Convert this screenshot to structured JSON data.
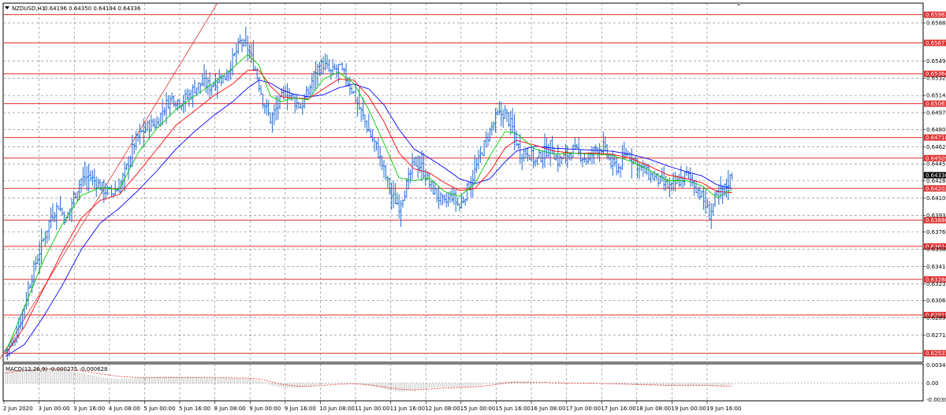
{
  "chart_data": [
    {
      "type": "candlestick",
      "title": "NZDUSD,H1",
      "ohlc_readout": "0.64196 0.64350 0.64194 0.64336",
      "price_range": [
        0.6244,
        0.6608
      ],
      "y_ticks": [
        "0.65880",
        "0.65495",
        "0.65320",
        "0.65145",
        "0.64970",
        "0.64800",
        "0.64625",
        "0.64450",
        "0.64280",
        "0.64105",
        "0.63930",
        "0.63760",
        "0.63585",
        "0.63410",
        "0.63235",
        "0.63065",
        "0.62890",
        "0.62715"
      ],
      "y_tick_values": [
        0.6588,
        0.65495,
        0.6532,
        0.65145,
        0.6497,
        0.648,
        0.64625,
        0.6445,
        0.6428,
        0.64105,
        0.6393,
        0.6376,
        0.63585,
        0.6341,
        0.63235,
        0.63065,
        0.6289,
        0.62715
      ],
      "x_ticks": [
        "2 Jun 2020",
        "3 Jun 00:00",
        "3 Jun 16:00",
        "4 Jun 08:00",
        "5 Jun 00:00",
        "5 Jun 16:00",
        "8 Jun 08:00",
        "9 Jun 00:00",
        "9 Jun 16:00",
        "10 Jun 08:00",
        "11 Jun 00:00",
        "11 Jun 16:00",
        "12 Jun 08:00",
        "15 Jun 00:00",
        "15 Jun 16:00",
        "16 Jun 08:00",
        "17 Jun 00:00",
        "17 Jun 16:00",
        "18 Jun 08:00",
        "19 Jun 00:00",
        "19 Jun 16:00"
      ],
      "levels": [
        "0.65963",
        "0.65677",
        "0.65364",
        "0.65061",
        "0.64718",
        "0.64509",
        "0.64202",
        "0.63880",
        "0.63614",
        "0.63280",
        "0.62919",
        "0.62531"
      ],
      "current_price": "0.64336",
      "price_path": [
        [
          0,
          0.6256
        ],
        [
          4,
          0.6263
        ],
        [
          8,
          0.6288
        ],
        [
          12,
          0.6318
        ],
        [
          16,
          0.6345
        ],
        [
          20,
          0.6368
        ],
        [
          24,
          0.6392
        ],
        [
          28,
          0.6403
        ],
        [
          32,
          0.6387
        ],
        [
          36,
          0.6412
        ],
        [
          40,
          0.6429
        ],
        [
          44,
          0.6433
        ],
        [
          48,
          0.6426
        ],
        [
          52,
          0.6419
        ],
        [
          56,
          0.6415
        ],
        [
          60,
          0.6421
        ],
        [
          64,
          0.6441
        ],
        [
          68,
          0.6466
        ],
        [
          72,
          0.6477
        ],
        [
          76,
          0.6484
        ],
        [
          80,
          0.6486
        ],
        [
          84,
          0.6503
        ],
        [
          88,
          0.6512
        ],
        [
          92,
          0.6508
        ],
        [
          96,
          0.6512
        ],
        [
          100,
          0.6522
        ],
        [
          104,
          0.6527
        ],
        [
          108,
          0.6524
        ],
        [
          112,
          0.6531
        ],
        [
          116,
          0.6533
        ],
        [
          120,
          0.655
        ],
        [
          124,
          0.6568
        ],
        [
          128,
          0.6562
        ],
        [
          132,
          0.6541
        ],
        [
          136,
          0.651
        ],
        [
          140,
          0.649
        ],
        [
          144,
          0.6504
        ],
        [
          148,
          0.6519
        ],
        [
          152,
          0.651
        ],
        [
          156,
          0.6503
        ],
        [
          160,
          0.6518
        ],
        [
          164,
          0.654
        ],
        [
          168,
          0.6546
        ],
        [
          172,
          0.6537
        ],
        [
          176,
          0.6543
        ],
        [
          180,
          0.6532
        ],
        [
          184,
          0.6517
        ],
        [
          188,
          0.6497
        ],
        [
          192,
          0.6478
        ],
        [
          196,
          0.6462
        ],
        [
          200,
          0.6438
        ],
        [
          204,
          0.6413
        ],
        [
          208,
          0.6403
        ],
        [
          212,
          0.6423
        ],
        [
          216,
          0.6447
        ],
        [
          220,
          0.6442
        ],
        [
          224,
          0.6425
        ],
        [
          228,
          0.6413
        ],
        [
          232,
          0.6404
        ],
        [
          236,
          0.6413
        ],
        [
          240,
          0.6401
        ],
        [
          244,
          0.6419
        ],
        [
          248,
          0.6437
        ],
        [
          252,
          0.6459
        ],
        [
          256,
          0.6478
        ],
        [
          260,
          0.6494
        ],
        [
          264,
          0.6497
        ],
        [
          268,
          0.6481
        ],
        [
          272,
          0.6456
        ],
        [
          276,
          0.6458
        ],
        [
          280,
          0.6447
        ],
        [
          284,
          0.6455
        ],
        [
          288,
          0.6463
        ],
        [
          292,
          0.6448
        ],
        [
          296,
          0.6453
        ],
        [
          300,
          0.6459
        ],
        [
          304,
          0.6454
        ],
        [
          308,
          0.6448
        ],
        [
          312,
          0.6461
        ],
        [
          316,
          0.6462
        ],
        [
          320,
          0.6445
        ],
        [
          324,
          0.6441
        ],
        [
          328,
          0.6456
        ],
        [
          332,
          0.645
        ],
        [
          336,
          0.644
        ],
        [
          340,
          0.6434
        ],
        [
          344,
          0.643
        ],
        [
          348,
          0.6424
        ],
        [
          352,
          0.6421
        ],
        [
          356,
          0.6428
        ],
        [
          360,
          0.6434
        ],
        [
          364,
          0.6425
        ],
        [
          368,
          0.6412
        ],
        [
          372,
          0.6394
        ],
        [
          376,
          0.6413
        ],
        [
          380,
          0.642
        ],
        [
          384,
          0.6434
        ]
      ],
      "ma_fast": [
        [
          0,
          0.6254
        ],
        [
          10,
          0.63
        ],
        [
          20,
          0.6347
        ],
        [
          30,
          0.6384
        ],
        [
          40,
          0.6413
        ],
        [
          50,
          0.6421
        ],
        [
          60,
          0.6419
        ],
        [
          70,
          0.6456
        ],
        [
          80,
          0.6481
        ],
        [
          90,
          0.65
        ],
        [
          100,
          0.6514
        ],
        [
          110,
          0.6527
        ],
        [
          120,
          0.6542
        ],
        [
          128,
          0.6556
        ],
        [
          134,
          0.6545
        ],
        [
          140,
          0.6514
        ],
        [
          146,
          0.6508
        ],
        [
          152,
          0.6512
        ],
        [
          160,
          0.651
        ],
        [
          168,
          0.6531
        ],
        [
          176,
          0.6538
        ],
        [
          184,
          0.6527
        ],
        [
          192,
          0.65
        ],
        [
          200,
          0.6466
        ],
        [
          208,
          0.6431
        ],
        [
          216,
          0.6428
        ],
        [
          224,
          0.6431
        ],
        [
          232,
          0.6417
        ],
        [
          240,
          0.6412
        ],
        [
          248,
          0.6425
        ],
        [
          256,
          0.6453
        ],
        [
          264,
          0.6478
        ],
        [
          270,
          0.6476
        ],
        [
          280,
          0.646
        ],
        [
          290,
          0.6455
        ],
        [
          300,
          0.6456
        ],
        [
          310,
          0.6455
        ],
        [
          320,
          0.6454
        ],
        [
          330,
          0.6448
        ],
        [
          340,
          0.6439
        ],
        [
          350,
          0.6428
        ],
        [
          360,
          0.6428
        ],
        [
          368,
          0.6423
        ],
        [
          376,
          0.6411
        ],
        [
          384,
          0.6419
        ]
      ],
      "ma_mid": [
        [
          0,
          0.6252
        ],
        [
          10,
          0.628
        ],
        [
          20,
          0.6318
        ],
        [
          30,
          0.6356
        ],
        [
          40,
          0.639
        ],
        [
          50,
          0.6408
        ],
        [
          60,
          0.6414
        ],
        [
          70,
          0.6436
        ],
        [
          80,
          0.646
        ],
        [
          90,
          0.6484
        ],
        [
          100,
          0.6499
        ],
        [
          110,
          0.6514
        ],
        [
          120,
          0.6526
        ],
        [
          128,
          0.654
        ],
        [
          134,
          0.654
        ],
        [
          140,
          0.6524
        ],
        [
          146,
          0.6513
        ],
        [
          152,
          0.6512
        ],
        [
          160,
          0.6511
        ],
        [
          168,
          0.6521
        ],
        [
          176,
          0.6531
        ],
        [
          184,
          0.653
        ],
        [
          192,
          0.6513
        ],
        [
          200,
          0.6488
        ],
        [
          208,
          0.6456
        ],
        [
          216,
          0.644
        ],
        [
          224,
          0.6436
        ],
        [
          232,
          0.6426
        ],
        [
          240,
          0.6418
        ],
        [
          248,
          0.642
        ],
        [
          256,
          0.6437
        ],
        [
          264,
          0.6461
        ],
        [
          270,
          0.6469
        ],
        [
          280,
          0.6464
        ],
        [
          290,
          0.6458
        ],
        [
          300,
          0.6456
        ],
        [
          310,
          0.6456
        ],
        [
          320,
          0.6455
        ],
        [
          330,
          0.6451
        ],
        [
          340,
          0.6443
        ],
        [
          350,
          0.6434
        ],
        [
          360,
          0.643
        ],
        [
          368,
          0.6426
        ],
        [
          376,
          0.6417
        ],
        [
          384,
          0.6416
        ]
      ],
      "ma_slow": [
        [
          0,
          0.625
        ],
        [
          10,
          0.6262
        ],
        [
          20,
          0.629
        ],
        [
          30,
          0.6322
        ],
        [
          40,
          0.6358
        ],
        [
          50,
          0.6385
        ],
        [
          60,
          0.64
        ],
        [
          70,
          0.6418
        ],
        [
          80,
          0.6438
        ],
        [
          90,
          0.646
        ],
        [
          100,
          0.6478
        ],
        [
          110,
          0.6494
        ],
        [
          120,
          0.6508
        ],
        [
          128,
          0.6522
        ],
        [
          134,
          0.653
        ],
        [
          140,
          0.6527
        ],
        [
          146,
          0.652
        ],
        [
          152,
          0.6516
        ],
        [
          160,
          0.6513
        ],
        [
          168,
          0.6515
        ],
        [
          176,
          0.6522
        ],
        [
          184,
          0.6526
        ],
        [
          192,
          0.6521
        ],
        [
          200,
          0.6505
        ],
        [
          208,
          0.648
        ],
        [
          216,
          0.646
        ],
        [
          224,
          0.6451
        ],
        [
          232,
          0.6441
        ],
        [
          240,
          0.643
        ],
        [
          248,
          0.6425
        ],
        [
          256,
          0.643
        ],
        [
          264,
          0.6447
        ],
        [
          270,
          0.6458
        ],
        [
          280,
          0.6463
        ],
        [
          290,
          0.6461
        ],
        [
          300,
          0.646
        ],
        [
          310,
          0.6459
        ],
        [
          320,
          0.6458
        ],
        [
          330,
          0.6455
        ],
        [
          340,
          0.645
        ],
        [
          350,
          0.6443
        ],
        [
          360,
          0.6437
        ],
        [
          368,
          0.6433
        ],
        [
          376,
          0.6424
        ],
        [
          384,
          0.642
        ]
      ],
      "trendline": [
        [
          -4,
          0.6244
        ],
        [
          112,
          0.6608
        ]
      ],
      "colors": {
        "price": "#1e6bd6",
        "ma_fast": "#00cc00",
        "ma_mid": "#ff0000",
        "ma_slow": "#0000ff",
        "level": "#e03030",
        "grid": "#7a7a7a",
        "border": "#000000",
        "current_bg": "#000000"
      }
    },
    {
      "type": "bar",
      "title": "MACD(12,26,9) -0.000275 -0.000628",
      "y_ticks": [
        "0.003476",
        "0.00",
        "-0.003092"
      ],
      "y_tick_values": [
        0.003476,
        0.0,
        -0.003092
      ],
      "y_range": [
        -0.00335,
        0.0037
      ],
      "histogram": [
        [
          0,
          0.0022
        ],
        [
          10,
          0.0028
        ],
        [
          20,
          0.003
        ],
        [
          30,
          0.0026
        ],
        [
          40,
          0.002
        ],
        [
          50,
          0.0012
        ],
        [
          60,
          0.0008
        ],
        [
          70,
          0.001
        ],
        [
          80,
          0.0012
        ],
        [
          90,
          0.0012
        ],
        [
          100,
          0.0011
        ],
        [
          110,
          0.001
        ],
        [
          120,
          0.001
        ],
        [
          128,
          0.0009
        ],
        [
          134,
          0.0005
        ],
        [
          140,
          -0.0004
        ],
        [
          146,
          -0.0008
        ],
        [
          152,
          -0.0009
        ],
        [
          160,
          -0.0006
        ],
        [
          168,
          -0.0002
        ],
        [
          176,
          0.0001
        ],
        [
          184,
          -0.0001
        ],
        [
          192,
          -0.0005
        ],
        [
          200,
          -0.0011
        ],
        [
          208,
          -0.0016
        ],
        [
          216,
          -0.0014
        ],
        [
          224,
          -0.0008
        ],
        [
          232,
          -0.0007
        ],
        [
          240,
          -0.0008
        ],
        [
          248,
          -0.0006
        ],
        [
          256,
          0.0
        ],
        [
          264,
          0.0004
        ],
        [
          270,
          0.0003
        ],
        [
          280,
          0.0001
        ],
        [
          290,
          0.0
        ],
        [
          300,
          0.0
        ],
        [
          310,
          -0.0001
        ],
        [
          320,
          -0.0001
        ],
        [
          330,
          -0.0003
        ],
        [
          340,
          -0.0004
        ],
        [
          350,
          -0.0005
        ],
        [
          360,
          -0.0004
        ],
        [
          368,
          -0.0004
        ],
        [
          376,
          -0.0006
        ],
        [
          384,
          -0.0003
        ]
      ],
      "signal": [
        [
          0,
          0.002
        ],
        [
          10,
          0.0024
        ],
        [
          20,
          0.0027
        ],
        [
          30,
          0.0027
        ],
        [
          40,
          0.0024
        ],
        [
          50,
          0.0018
        ],
        [
          60,
          0.0013
        ],
        [
          70,
          0.0011
        ],
        [
          80,
          0.0011
        ],
        [
          90,
          0.0011
        ],
        [
          100,
          0.0011
        ],
        [
          110,
          0.0011
        ],
        [
          120,
          0.001
        ],
        [
          128,
          0.001
        ],
        [
          134,
          0.0008
        ],
        [
          140,
          0.0003
        ],
        [
          146,
          -0.0002
        ],
        [
          152,
          -0.0005
        ],
        [
          160,
          -0.0006
        ],
        [
          168,
          -0.0004
        ],
        [
          176,
          -0.0002
        ],
        [
          184,
          -0.0001
        ],
        [
          192,
          -0.0003
        ],
        [
          200,
          -0.0007
        ],
        [
          208,
          -0.0011
        ],
        [
          216,
          -0.0013
        ],
        [
          224,
          -0.0011
        ],
        [
          232,
          -0.0009
        ],
        [
          240,
          -0.0008
        ],
        [
          248,
          -0.0007
        ],
        [
          256,
          -0.0004
        ],
        [
          264,
          0.0
        ],
        [
          270,
          0.0002
        ],
        [
          280,
          0.0002
        ],
        [
          290,
          0.0001
        ],
        [
          300,
          0.0
        ],
        [
          310,
          0.0
        ],
        [
          320,
          -0.0001
        ],
        [
          330,
          -0.0002
        ],
        [
          340,
          -0.0003
        ],
        [
          350,
          -0.0004
        ],
        [
          360,
          -0.0004
        ],
        [
          368,
          -0.0004
        ],
        [
          376,
          -0.0005
        ],
        [
          384,
          -0.0006
        ]
      ],
      "colors": {
        "histogram": "#c0c0c0",
        "signal": "#e03030",
        "zero": "#7a7a7a"
      }
    }
  ]
}
